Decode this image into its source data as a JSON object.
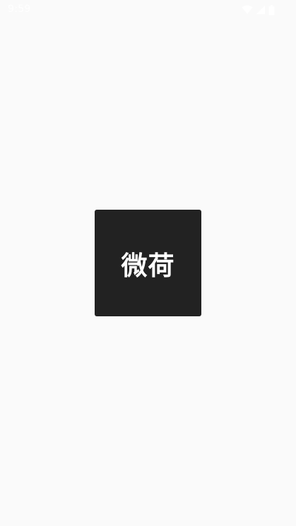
{
  "status_bar": {
    "time": "9:59",
    "icons": [
      "wifi-icon",
      "cellular-signal-icon",
      "battery-icon"
    ]
  },
  "splash": {
    "logo_text": "微荷",
    "logo_bg_color": "#222222",
    "background_color": "#fafafa"
  }
}
